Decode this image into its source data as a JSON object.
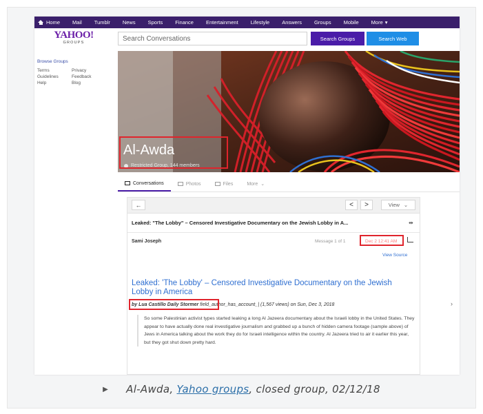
{
  "nav": {
    "items": [
      "Home",
      "Mail",
      "Tumblr",
      "News",
      "Sports",
      "Finance",
      "Entertainment",
      "Lifestyle",
      "Answers",
      "Groups",
      "Mobile",
      "More"
    ]
  },
  "header": {
    "logo_main": "YAHOO!",
    "logo_sub": "GROUPS",
    "search_placeholder": "Search Conversations",
    "search_groups_label": "Search Groups",
    "search_web_label": "Search Web"
  },
  "sidebar": {
    "title": "Browse Groups",
    "links": [
      "Terms",
      "Privacy",
      "Guidelines",
      "Feedback",
      "Help",
      "Blog"
    ]
  },
  "group": {
    "name": "Al-Awda",
    "info": "Restricted Group, 144 members"
  },
  "tabs": [
    "Conversations",
    "Photos",
    "Files",
    "More"
  ],
  "message": {
    "back": "←",
    "prev": "<",
    "next": ">",
    "view_label": "View",
    "subject": "Leaked: \"The Lobby\" – Censored Investigative Documentary on the Jewish Lobby in A...",
    "author": "Sami Joseph",
    "count": "Message 1 of 1",
    "date": "Dec 2 12:41 AM",
    "view_source": "View Source",
    "title": "Leaked: 'The Lobby' – Censored Investigative Documentary on the Jewish Lobby in America",
    "byline_author": "by Lua Castillo Daily Stormer",
    "byline_rest": "field_author_has_account_| (1,567 views) on Sun, Dec 3, 2018",
    "body": "So some Palestinian activist types started leaking a long Al Jazeera documentary about the Israeli lobby in the United States. They appear to have actually done real investigative journalism and grabbed up a bunch of hidden camera footage (sample above) of Jews in America talking about the work they do for Israeli intelligence within the country. Al Jazeera tried to air it earlier this year, but they got shut down pretty hard."
  },
  "caption": {
    "prefix": "Al-Awda, ",
    "link": "Yahoo groups",
    "suffix": ", closed group, 02/12/18"
  },
  "colors": {
    "nav_bg": "#3a1f6b",
    "brand_purple": "#4a1ca8",
    "link_blue": "#2f6fd1",
    "highlight_red": "#e0242c"
  }
}
